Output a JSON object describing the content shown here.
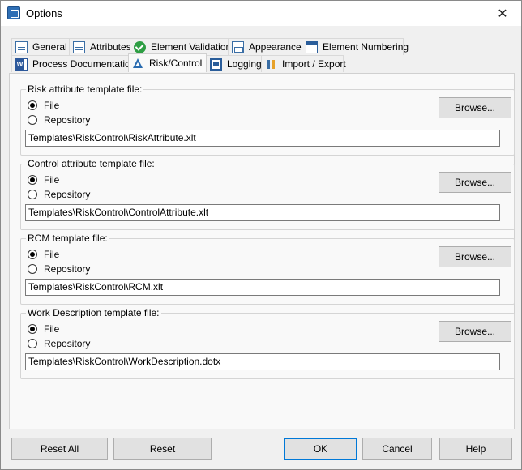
{
  "window": {
    "title": "Options",
    "close": "✕"
  },
  "tabs_row1": [
    {
      "label": "General",
      "icon": "general-icon"
    },
    {
      "label": "Attributes",
      "icon": "attributes-icon"
    },
    {
      "label": "Element Validation",
      "icon": "validation-check-icon"
    },
    {
      "label": "Appearance",
      "icon": "appearance-icon"
    },
    {
      "label": "Element Numbering",
      "icon": "numbering-icon"
    }
  ],
  "tabs_row2": [
    {
      "label": "Process Documentation",
      "icon": "word-document-icon"
    },
    {
      "label": "Risk/Control",
      "icon": "risk-control-icon",
      "active": true
    },
    {
      "label": "Logging",
      "icon": "logging-icon"
    },
    {
      "label": "Import / Export",
      "icon": "import-export-icon"
    }
  ],
  "groups": [
    {
      "label": "Risk attribute template file:",
      "option_file": "File",
      "option_repository": "Repository",
      "selected": "File",
      "browse": "Browse...",
      "path": "Templates\\RiskControl\\RiskAttribute.xlt"
    },
    {
      "label": "Control attribute template file:",
      "option_file": "File",
      "option_repository": "Repository",
      "selected": "File",
      "browse": "Browse...",
      "path": "Templates\\RiskControl\\ControlAttribute.xlt"
    },
    {
      "label": "RCM template file:",
      "option_file": "File",
      "option_repository": "Repository",
      "selected": "File",
      "browse": "Browse...",
      "path": "Templates\\RiskControl\\RCM.xlt"
    },
    {
      "label": "Work Description template file:",
      "option_file": "File",
      "option_repository": "Repository",
      "selected": "File",
      "browse": "Browse...",
      "path": "Templates\\RiskControl\\WorkDescription.dotx"
    }
  ],
  "buttons": {
    "reset_all": "Reset All",
    "reset": "Reset",
    "ok": "OK",
    "cancel": "Cancel",
    "help": "Help"
  },
  "colors": {
    "accent": "#0078d7",
    "panel_bg": "#f9f9f9",
    "dialog_bg": "#f0f0f0"
  }
}
